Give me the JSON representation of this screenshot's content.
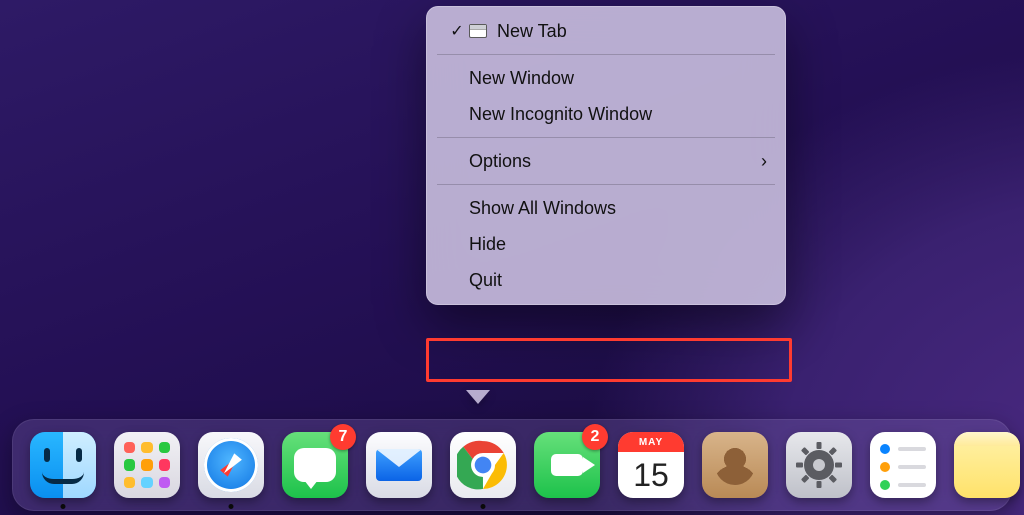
{
  "context_menu": {
    "new_tab": "New Tab",
    "new_window": "New Window",
    "new_incognito": "New Incognito Window",
    "options": "Options",
    "show_all": "Show All Windows",
    "hide": "Hide",
    "quit": "Quit"
  },
  "calendar": {
    "month": "MAY",
    "day": "15"
  },
  "badges": {
    "messages": "7",
    "facetime": "2"
  },
  "reminder_colors": [
    "#0a84ff",
    "#ff9f0a",
    "#30d158"
  ]
}
